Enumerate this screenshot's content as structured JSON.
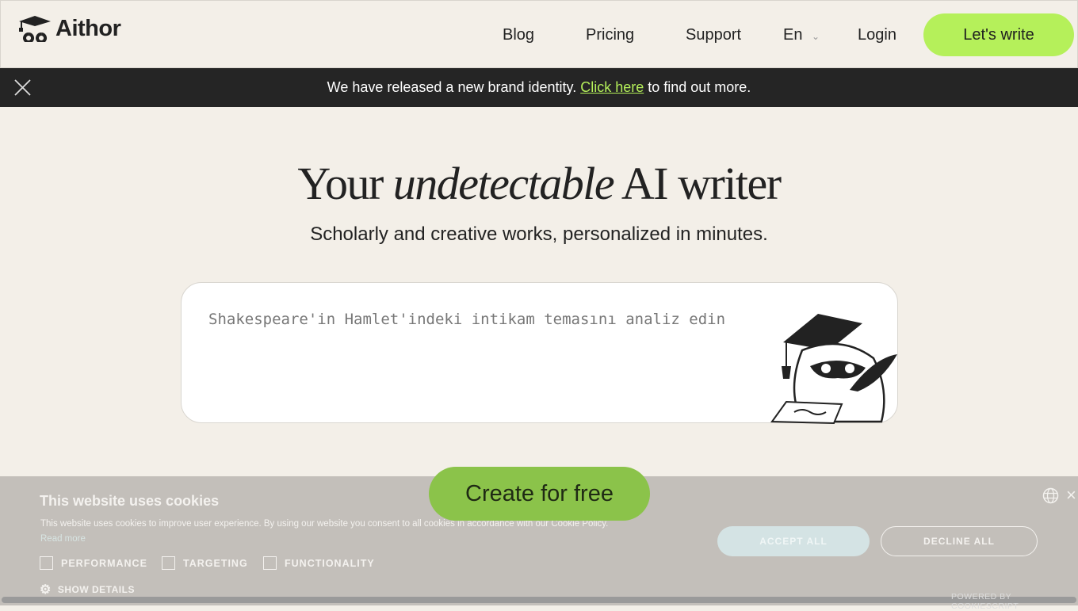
{
  "nav": {
    "brand": "Aithor",
    "links": [
      "Blog",
      "Pricing",
      "Support"
    ],
    "language": "En",
    "login": "Login",
    "cta": "Let's write"
  },
  "banner": {
    "text_before": "We have released a new brand identity.",
    "link": "Click here",
    "text_after": "to find out more."
  },
  "hero": {
    "title_start": "Your",
    "title_italic": "undetectable",
    "title_end": "AI writer",
    "subtitle": "Scholarly and creative works, personalized in minutes.",
    "prompt_placeholder": "Shakespeare'in Hamlet'indeki intikam temasını analiz edin",
    "create_button": "Create for free"
  },
  "cookie": {
    "title": "This website uses cookies",
    "text": "This website uses cookies to improve user experience. By using our website you consent to all cookies in accordance with our Cookie Policy.",
    "read_more": "Read more",
    "options": [
      "PERFORMANCE",
      "TARGETING",
      "FUNCTIONALITY"
    ],
    "show_details": "SHOW DETAILS",
    "accept": "ACCEPT ALL",
    "decline": "DECLINE ALL",
    "powered": "POWERED BY COOKIESCRIPT"
  },
  "colors": {
    "accent": "#b5f05a",
    "create": "#8bc34a",
    "banner_bg": "#252525",
    "page_bg": "#f3efe8"
  }
}
